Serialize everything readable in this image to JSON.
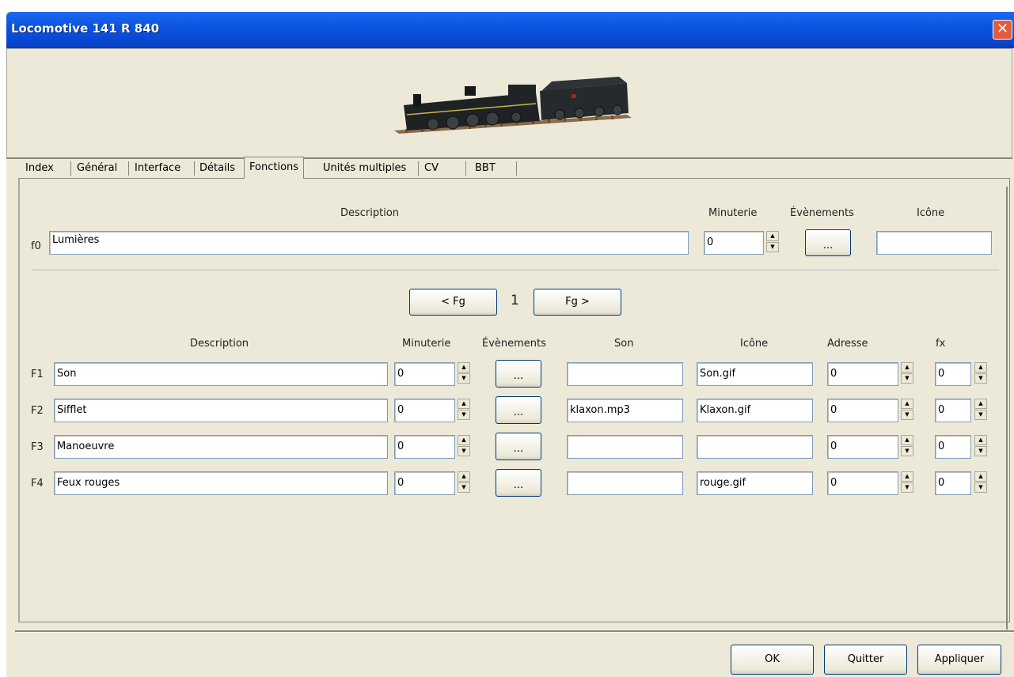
{
  "window": {
    "title": "Locomotive 141 R 840",
    "close_glyph": "✕"
  },
  "tabs": [
    {
      "label": "Index"
    },
    {
      "label": "Général"
    },
    {
      "label": "Interface"
    },
    {
      "label": "Détails"
    },
    {
      "label": "Fonctions",
      "active": true
    },
    {
      "label": "Unités multiples"
    },
    {
      "label": "CV"
    },
    {
      "label": "BBT"
    }
  ],
  "f0": {
    "headers": {
      "description": "Description",
      "timer": "Minuterie",
      "events": "Évènements",
      "icon": "Icône"
    },
    "label": "f0",
    "description": "Lumières",
    "timer": "0",
    "events_button": "...",
    "icon": ""
  },
  "group_nav": {
    "prev": "< Fg",
    "current": "1",
    "next": "Fg >"
  },
  "func_headers": {
    "description": "Description",
    "timer": "Minuterie",
    "events": "Évènements",
    "sound": "Son",
    "icon": "Icône",
    "address": "Adresse",
    "fx": "fx"
  },
  "functions": [
    {
      "label": "F1",
      "description": "Son",
      "timer": "0",
      "events_button": "...",
      "sound": "",
      "icon": "Son.gif",
      "address": "0",
      "fx": "0"
    },
    {
      "label": "F2",
      "description": "Sifflet",
      "timer": "0",
      "events_button": "...",
      "sound": "klaxon.mp3",
      "icon": "Klaxon.gif",
      "address": "0",
      "fx": "0"
    },
    {
      "label": "F3",
      "description": "Manoeuvre",
      "timer": "0",
      "events_button": "...",
      "sound": "",
      "icon": "",
      "address": "0",
      "fx": "0"
    },
    {
      "label": "F4",
      "description": "Feux rouges",
      "timer": "0",
      "events_button": "...",
      "sound": "",
      "icon": "rouge.gif",
      "address": "0",
      "fx": "0"
    }
  ],
  "footer": {
    "ok": "OK",
    "quit": "Quitter",
    "apply": "Appliquer"
  },
  "spin_glyphs": {
    "up": "▲",
    "down": "▼"
  },
  "colors": {
    "titlebar": "#0a54e0",
    "window_bg": "#ece9d8",
    "close_button": "#e35a3c",
    "field_border": "#7f9db9"
  }
}
